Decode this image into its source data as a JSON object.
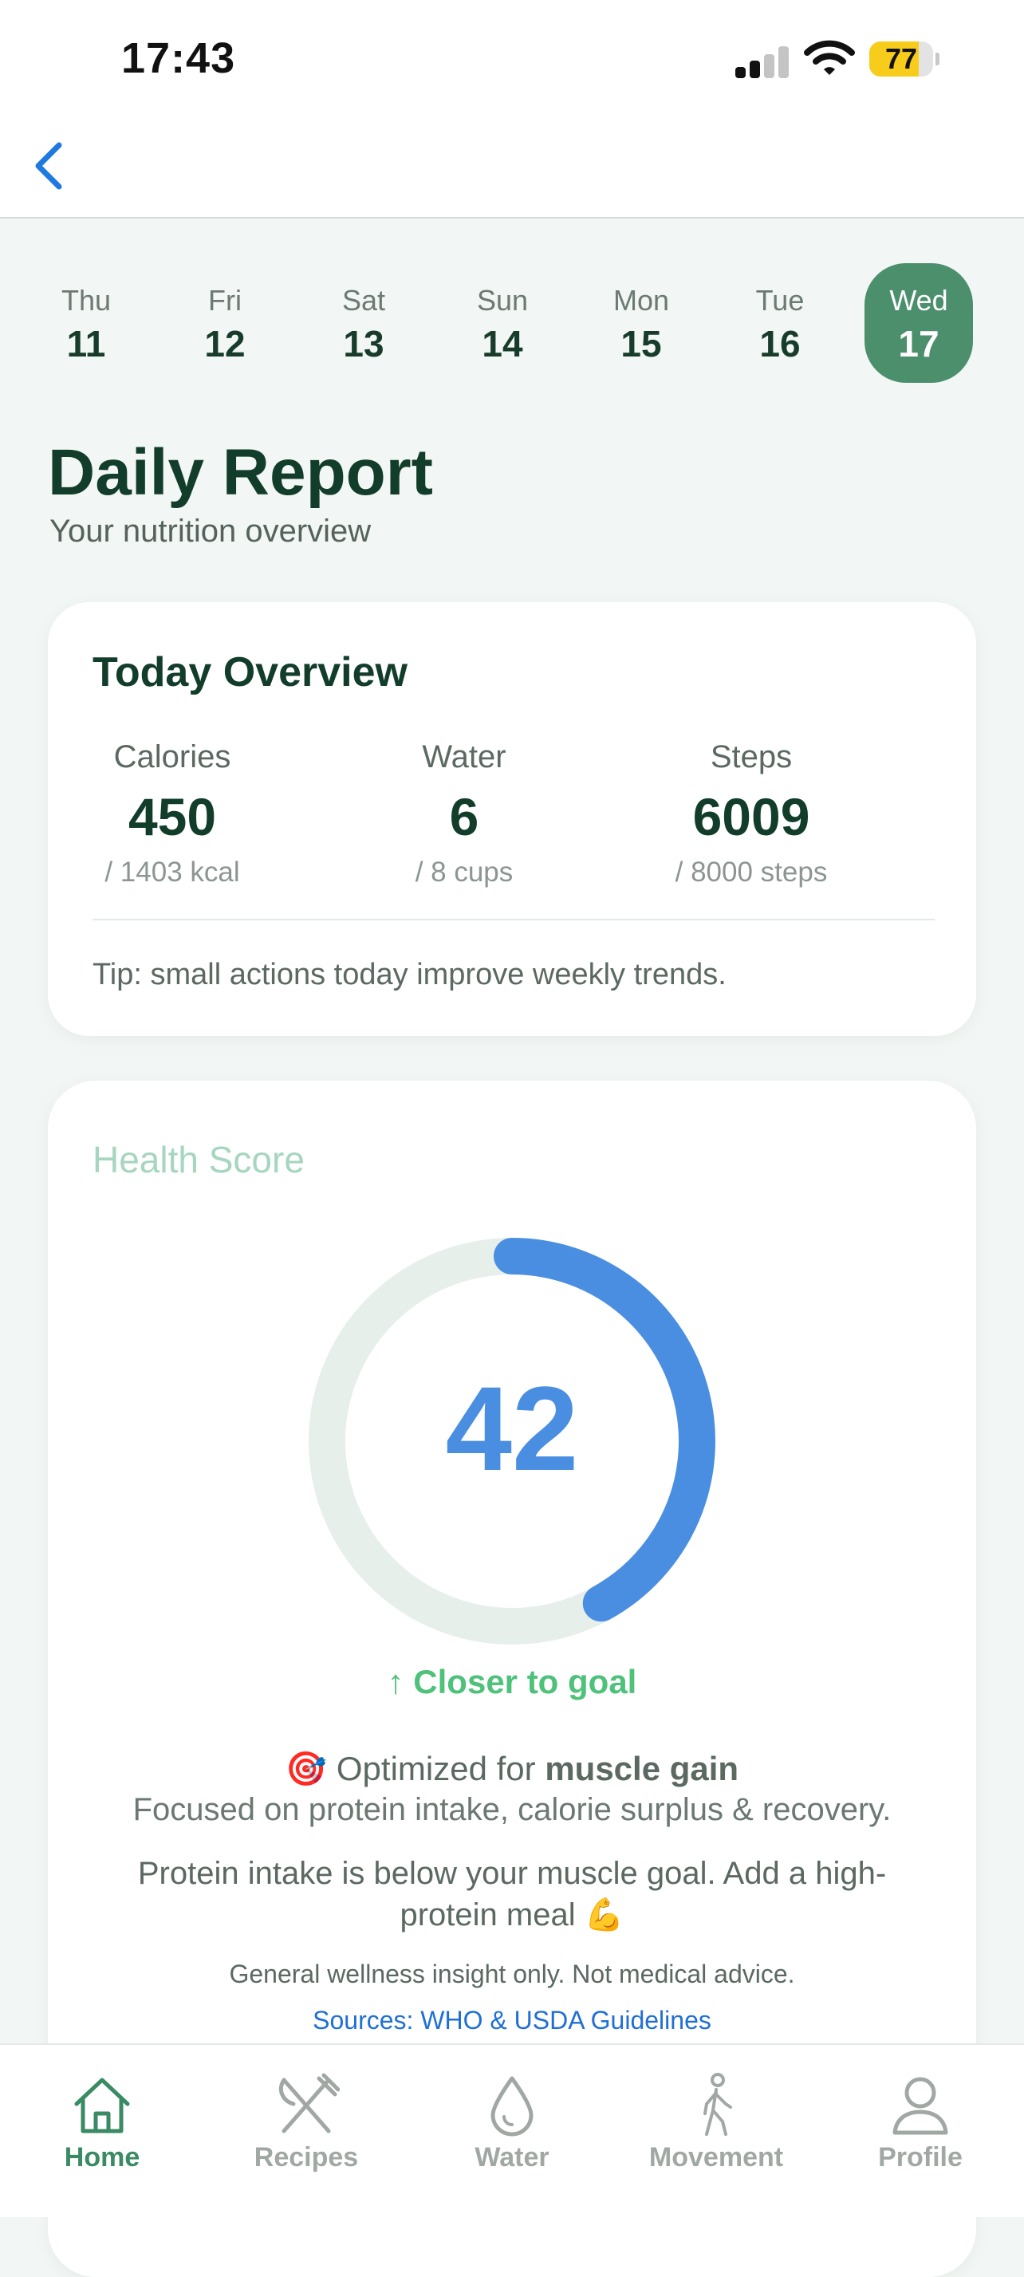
{
  "status_bar": {
    "time": "17:43",
    "battery_level": 77,
    "battery_text": "77",
    "signal_icon": "cellular-signal-icon",
    "wifi_icon": "wifi-icon"
  },
  "nav": {
    "back_icon": "chevron-left-icon",
    "accent_color": "#1f7ae0"
  },
  "dates": [
    {
      "dow": "Thu",
      "day": "11",
      "selected": false
    },
    {
      "dow": "Fri",
      "day": "12",
      "selected": false
    },
    {
      "dow": "Sat",
      "day": "13",
      "selected": false
    },
    {
      "dow": "Sun",
      "day": "14",
      "selected": false
    },
    {
      "dow": "Mon",
      "day": "15",
      "selected": false
    },
    {
      "dow": "Tue",
      "day": "16",
      "selected": false
    },
    {
      "dow": "Wed",
      "day": "17",
      "selected": true
    }
  ],
  "header": {
    "title": "Daily Report",
    "subtitle": "Your nutrition overview"
  },
  "overview": {
    "title": "Today Overview",
    "stats": [
      {
        "label": "Calories",
        "value": "450",
        "goal": "/ 1403 kcal"
      },
      {
        "label": "Water",
        "value": "6",
        "goal": "/ 8 cups"
      },
      {
        "label": "Steps",
        "value": "6009",
        "goal": "/ 8000 steps"
      }
    ],
    "tip": "Tip: small actions today improve weekly trends."
  },
  "health_score": {
    "title": "Health Score",
    "score": "42",
    "score_fraction": 0.42,
    "ring_color": "#4a8ee2",
    "track_color": "#e6efea",
    "trend": "↑ Closer to goal",
    "goal_prefix": "Optimized for",
    "goal_bold": "muscle gain",
    "goal_icon": "🎯",
    "goal_description": "Focused on protein intake, calorie surplus & recovery.",
    "insight": "Protein intake is below your muscle goal. Add a high-protein meal",
    "insight_icon": "💪",
    "disclaimer": "General wellness insight only. Not medical advice.",
    "sources": "Sources: WHO & USDA Guidelines"
  },
  "tabs": [
    {
      "label": "Home",
      "icon": "home-icon",
      "active": true
    },
    {
      "label": "Recipes",
      "icon": "utensils-icon",
      "active": false
    },
    {
      "label": "Water",
      "icon": "water-drop-icon",
      "active": false
    },
    {
      "label": "Movement",
      "icon": "walking-icon",
      "active": false
    },
    {
      "label": "Profile",
      "icon": "person-icon",
      "active": false
    }
  ],
  "colors": {
    "brand_green": "#4b8f6d",
    "title_green": "#123d2b",
    "trend_green": "#4ec17a",
    "link_blue": "#1f6fd6"
  }
}
